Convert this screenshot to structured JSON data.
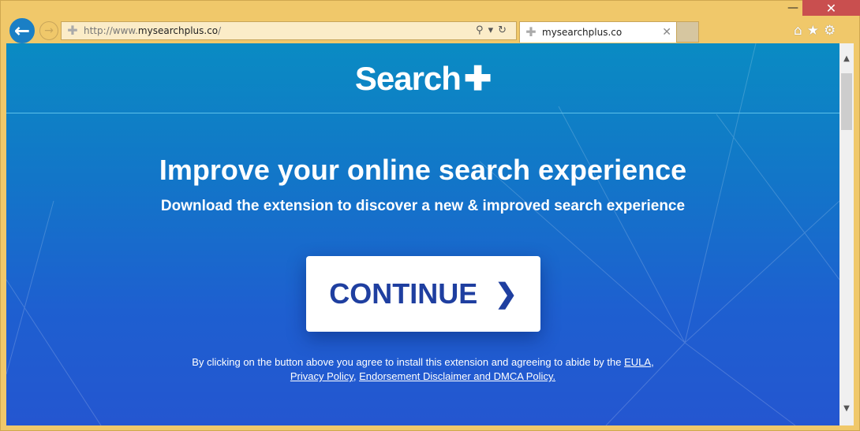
{
  "browser": {
    "url_prefix": "http://www.",
    "url_host": "mysearchplus.co",
    "url_suffix": "/",
    "tab_title": "mysearchplus.co",
    "window_controls": {
      "minimize": "—",
      "maximize": "☐",
      "close": "✕"
    },
    "icons": [
      "back-arrow-icon",
      "forward-arrow-icon",
      "site-favicon",
      "search-icon",
      "refresh-icon",
      "tab-close-icon",
      "home-icon",
      "star-icon",
      "gear-icon"
    ]
  },
  "page": {
    "logo": "Search",
    "headline": "Improve your online search experience",
    "subheadline": "Download the extension to discover a new & improved search experience",
    "continue_label": "CONTINUE",
    "legal_text": "By clicking on the button above you agree to install this extension and agreeing to abide by the ",
    "links": {
      "eula": "EULA",
      "privacy": "Privacy Policy",
      "endorsement": "Endorsement Disclaimer and DMCA Policy."
    },
    "sep": ", "
  },
  "colors": {
    "frame": "#f0c86a",
    "bg_top": "#0a8bc3",
    "bg_bottom": "#2456d0",
    "button_text": "#1f3fa0",
    "close": "#c94f4f"
  }
}
